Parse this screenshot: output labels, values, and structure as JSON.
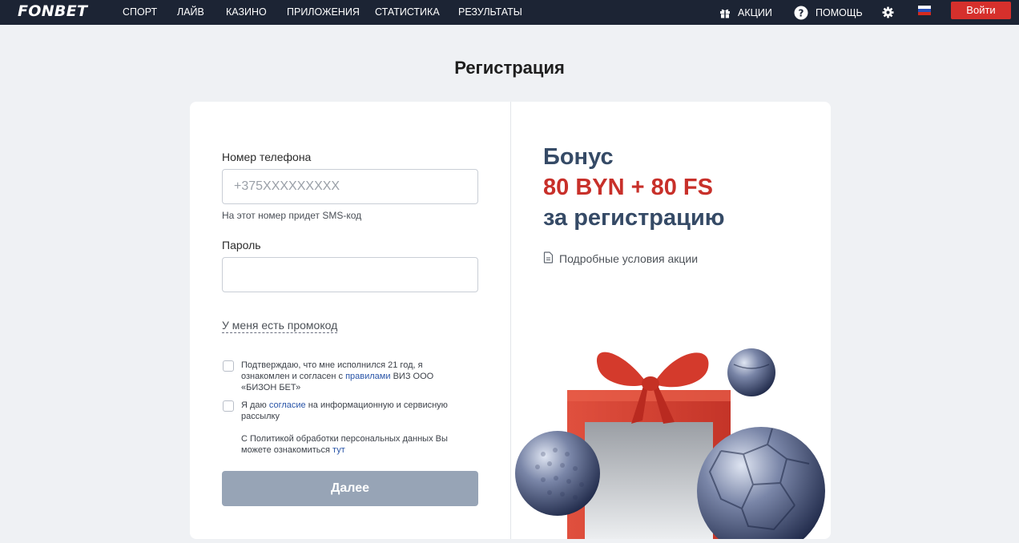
{
  "header": {
    "logo": "FONBET",
    "nav": [
      "СПОРТ",
      "ЛАЙВ",
      "КАЗИНО",
      "ПРИЛОЖЕНИЯ",
      "СТАТИСТИКА",
      "РЕЗУЛЬТАТЫ"
    ],
    "promos_label": "АКЦИИ",
    "help_label": "ПОМОЩЬ",
    "login_label": "Войти"
  },
  "page": {
    "title": "Регистрация"
  },
  "form": {
    "phone_label": "Номер телефона",
    "phone_placeholder": "+375XXXXXXXXX",
    "phone_hint": "На этот номер придет SMS-код",
    "password_label": "Пароль",
    "password_value": "",
    "promo_link": "У меня есть промокод",
    "age_text_1": "Подтверждаю, что мне исполнился 21 год, я ознакомлен и согласен с ",
    "age_link": "правилами",
    "age_text_2": " ВИЗ ООО «БИЗОН БЕТ»",
    "consent_text_1": "Я даю ",
    "consent_link": "согласие",
    "consent_text_2": " на информационную и сервисную рассылку",
    "policy_text": "С Политикой обработки персональных данных Вы можете ознакомиться ",
    "policy_link": "тут",
    "submit_label": "Далее"
  },
  "promo_panel": {
    "line1": "Бонус",
    "line2": "80 BYN + 80 FS",
    "line3": "за регистрацию",
    "terms_link": "Подробные условия акции"
  },
  "colors": {
    "header_bg": "#1c2434",
    "accent_red": "#d6302c",
    "bonus_blue": "#354a66",
    "bonus_red": "#c8302a",
    "disabled_button": "#97a4b6"
  }
}
